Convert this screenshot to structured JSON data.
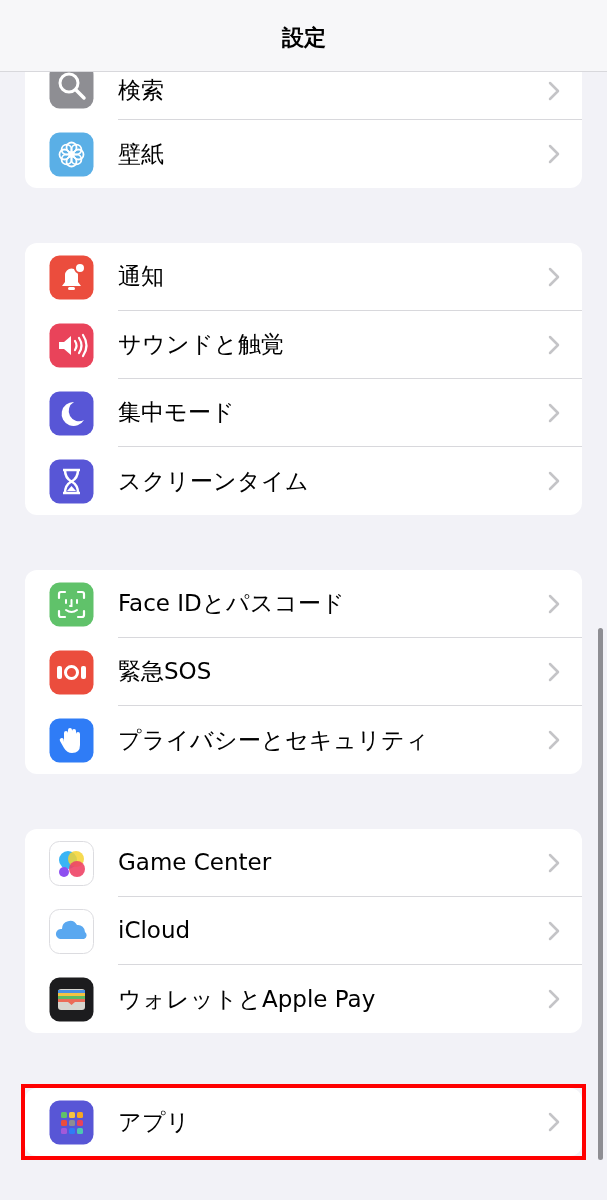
{
  "navigation_bar": {
    "title": "設定"
  },
  "groups": [
    {
      "items": [
        {
          "label": "検索",
          "highlighted": false
        },
        {
          "label": "壁紙",
          "highlighted": false
        }
      ]
    },
    {
      "items": [
        {
          "label": "通知",
          "highlighted": false
        },
        {
          "label": "サウンドと触覚",
          "highlighted": false
        },
        {
          "label": "集中モード",
          "highlighted": false
        },
        {
          "label": "スクリーンタイム",
          "highlighted": false
        }
      ]
    },
    {
      "items": [
        {
          "label": "Face IDとパスコード",
          "highlighted": false
        },
        {
          "label": "緊急SOS",
          "highlighted": false
        },
        {
          "label": "プライバシーとセキュリティ",
          "highlighted": false
        }
      ]
    },
    {
      "items": [
        {
          "label": "Game Center",
          "highlighted": false
        },
        {
          "label": "iCloud",
          "highlighted": false
        },
        {
          "label": "ウォレットとApple Pay",
          "highlighted": false
        }
      ]
    },
    {
      "items": [
        {
          "label": "アプリ",
          "highlighted": true
        }
      ]
    }
  ]
}
